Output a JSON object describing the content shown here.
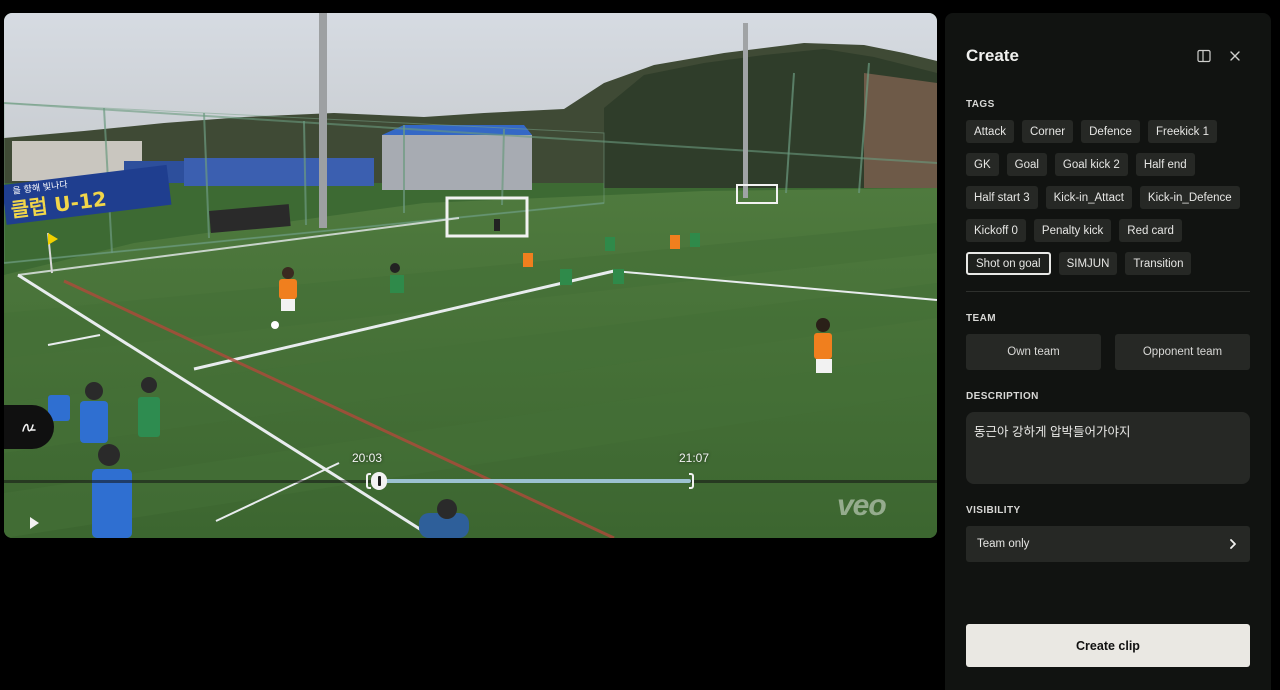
{
  "video": {
    "time_start": "20:03",
    "time_end": "21:07",
    "watermark": "veo",
    "banner_text": "클럽 U-12",
    "banner_text_2": "을 향해 빛나다",
    "play_icon": "play-icon",
    "handle_icon": "drawing-icon"
  },
  "panel": {
    "title": "Create",
    "tags_label": "TAGS",
    "tags": [
      {
        "label": "Attack",
        "selected": false
      },
      {
        "label": "Corner",
        "selected": false
      },
      {
        "label": "Defence",
        "selected": false
      },
      {
        "label": "Freekick 1",
        "selected": false
      },
      {
        "label": "GK",
        "selected": false
      },
      {
        "label": "Goal",
        "selected": false
      },
      {
        "label": "Goal kick 2",
        "selected": false
      },
      {
        "label": "Half end",
        "selected": false
      },
      {
        "label": "Half start 3",
        "selected": false
      },
      {
        "label": "Kick-in_Attact",
        "selected": false
      },
      {
        "label": "Kick-in_Defence",
        "selected": false
      },
      {
        "label": "Kickoff 0",
        "selected": false
      },
      {
        "label": "Penalty kick",
        "selected": false
      },
      {
        "label": "Red card",
        "selected": false
      },
      {
        "label": "Shot on goal",
        "selected": true
      },
      {
        "label": "SIMJUN",
        "selected": false
      },
      {
        "label": "Transition",
        "selected": false
      }
    ],
    "team_label": "TEAM",
    "team_own": "Own team",
    "team_opponent": "Opponent team",
    "description_label": "DESCRIPTION",
    "description_value": "동근아 강하게 압박들어가야지",
    "visibility_label": "VISIBILITY",
    "visibility_value": "Team only",
    "create_button": "Create clip"
  },
  "colors": {
    "panel_bg": "#111311",
    "chip_bg": "#262825",
    "create_bg": "#eae8e3",
    "clip_range": "#9cc2d1"
  }
}
